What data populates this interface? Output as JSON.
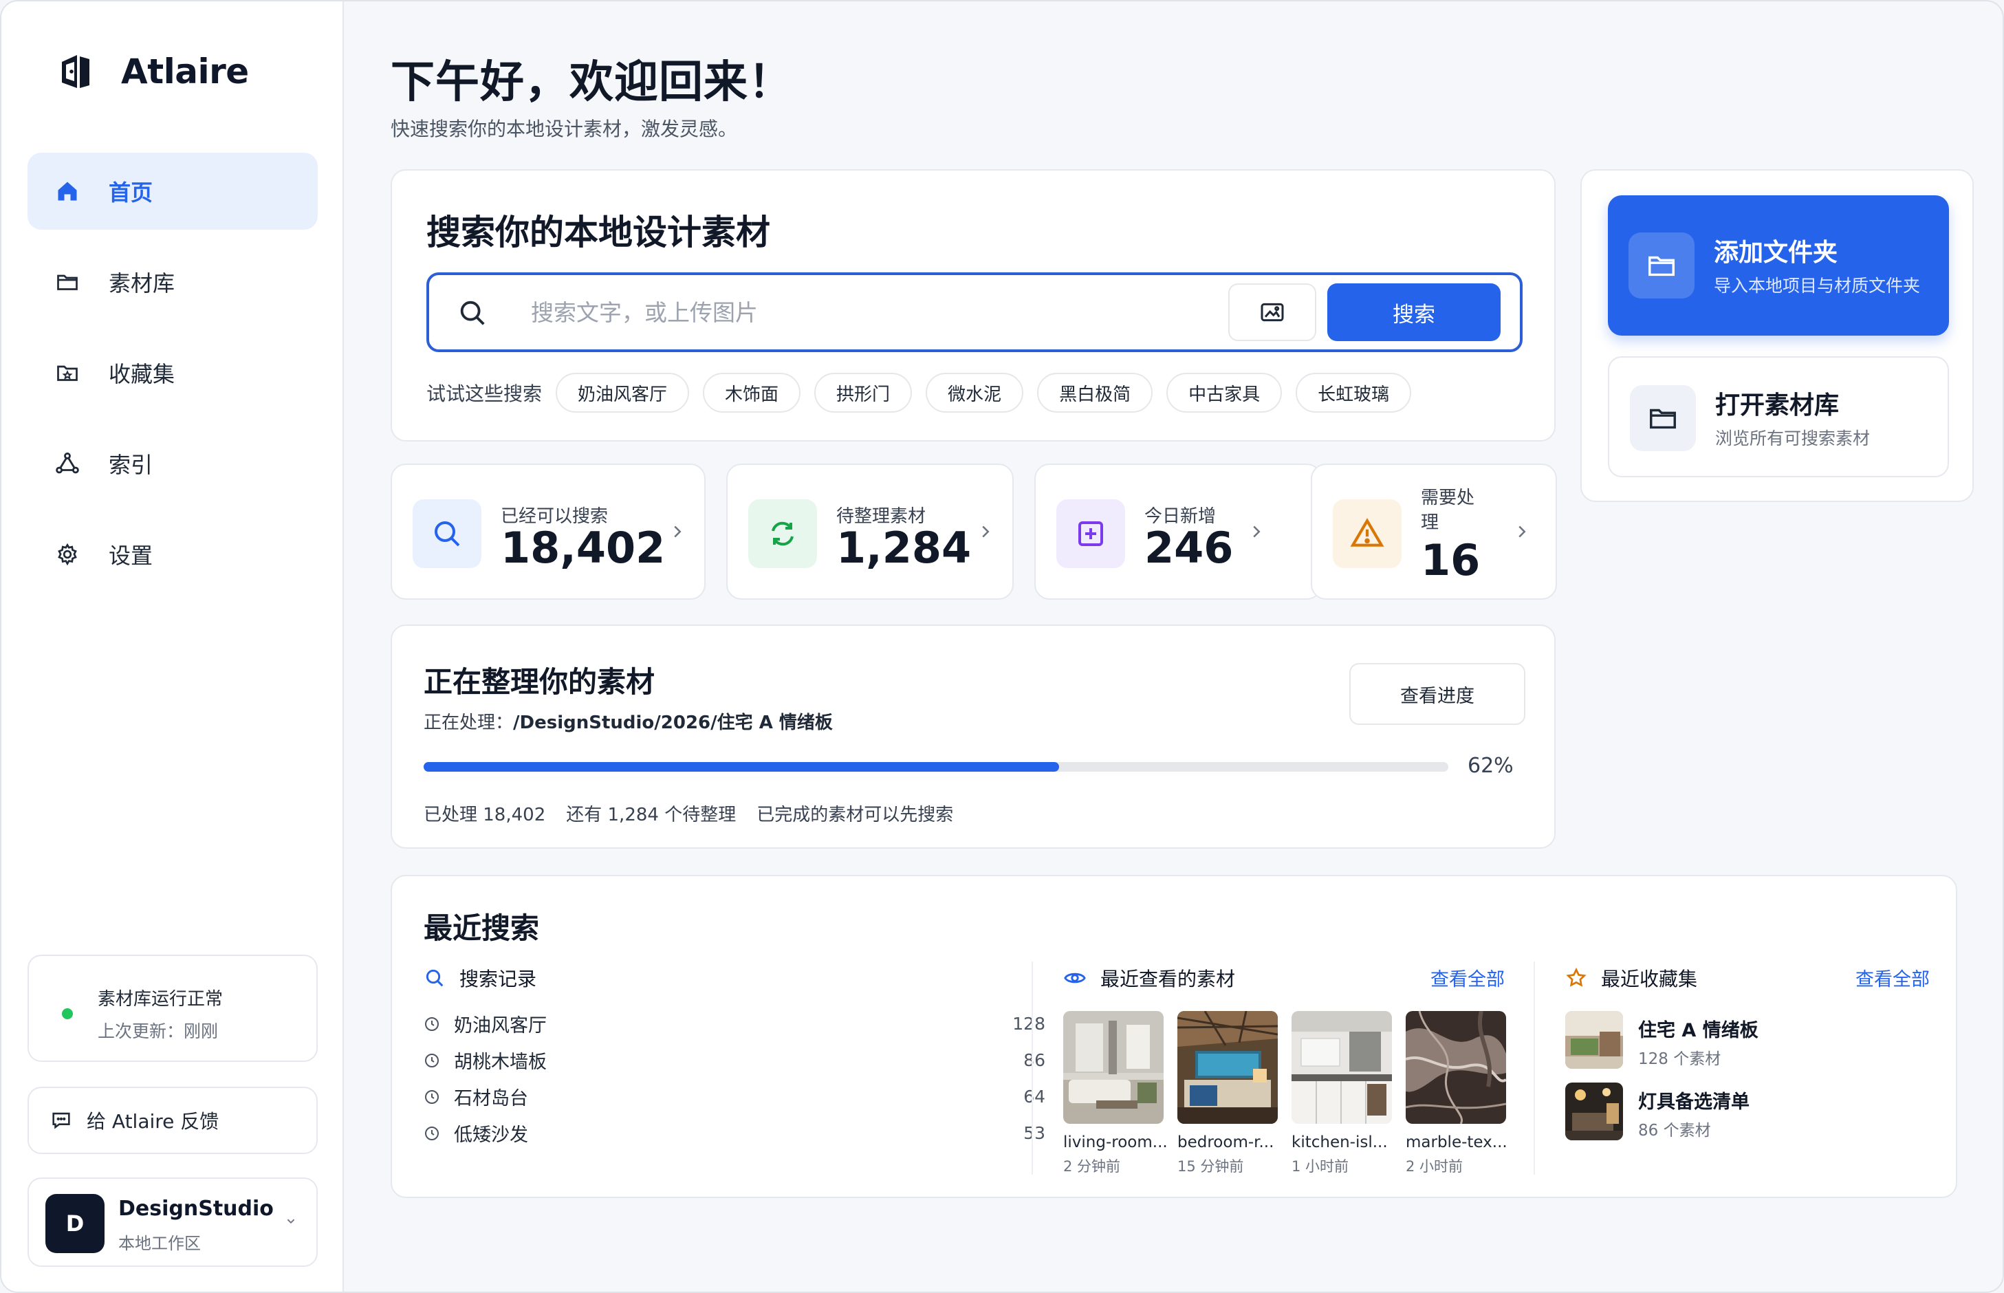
{
  "app": {
    "name": "Atlaire"
  },
  "sidebar": {
    "items": [
      {
        "label": "首页",
        "icon": "home-icon",
        "active": true
      },
      {
        "label": "素材库",
        "icon": "folder-icon",
        "active": false
      },
      {
        "label": "收藏集",
        "icon": "collection-icon",
        "active": false
      },
      {
        "label": "索引",
        "icon": "index-icon",
        "active": false
      },
      {
        "label": "设置",
        "icon": "gear-icon",
        "active": false
      }
    ],
    "status": {
      "title": "素材库运行正常",
      "updated": "上次更新：刚刚"
    },
    "feedback_label": "给 Atlaire 反馈",
    "workspace": {
      "initial": "D",
      "name": "DesignStudio",
      "type": "本地工作区"
    }
  },
  "header": {
    "greeting": "下午好，欢迎回来！",
    "subtitle": "快速搜索你的本地设计素材，激发灵感。"
  },
  "search": {
    "title": "搜索你的本地设计素材",
    "placeholder": "搜索文字，或上传图片",
    "button": "搜索",
    "suggest_label": "试试这些搜索",
    "suggestions": [
      "奶油风客厅",
      "木饰面",
      "拱形门",
      "微水泥",
      "黑白极简",
      "中古家具",
      "长虹玻璃"
    ]
  },
  "actions": {
    "add_folder": {
      "title": "添加文件夹",
      "subtitle": "导入本地项目与材质文件夹"
    },
    "open_library": {
      "title": "打开素材库",
      "subtitle": "浏览所有可搜索素材"
    }
  },
  "stats": [
    {
      "label": "已经可以搜索",
      "value": "18,402",
      "color": "#2563eb",
      "bg": "#eaf1fe"
    },
    {
      "label": "待整理素材",
      "value": "1,284",
      "color": "#16a34a",
      "bg": "#e8f7ee"
    },
    {
      "label": "今日新增",
      "value": "246",
      "color": "#7c3aed",
      "bg": "#f1ecfd"
    },
    {
      "label": "需要处理",
      "value": "16",
      "color": "#d97706",
      "bg": "#fdf3e4"
    }
  ],
  "progress": {
    "title": "正在整理你的素材",
    "path_label": "正在处理：",
    "path": "/DesignStudio/2026/住宅 A 情绪板",
    "button": "查看进度",
    "percent": 62,
    "percent_label": "62%",
    "processed": "已处理 18,402",
    "remaining": "还有 1,284 个待整理",
    "note": "已完成的素材可以先搜索"
  },
  "recent": {
    "title": "最近搜索",
    "history_title": "搜索记录",
    "history": [
      {
        "query": "奶油风客厅",
        "count": "128"
      },
      {
        "query": "胡桃木墙板",
        "count": "86"
      },
      {
        "query": "石材岛台",
        "count": "64"
      },
      {
        "query": "低矮沙发",
        "count": "53"
      }
    ],
    "viewed_title": "最近查看的素材",
    "viewed_see_all": "查看全部",
    "viewed": [
      {
        "name": "living-room...",
        "time": "2 分钟前"
      },
      {
        "name": "bedroom-r...",
        "time": "15 分钟前"
      },
      {
        "name": "kitchen-isl...",
        "time": "1 小时前"
      },
      {
        "name": "marble-tex...",
        "time": "2 小时前"
      }
    ],
    "collections_title": "最近收藏集",
    "collections_see_all": "查看全部",
    "collections": [
      {
        "name": "住宅 A 情绪板",
        "count": "128 个素材"
      },
      {
        "name": "灯具备选清单",
        "count": "86 个素材"
      }
    ]
  },
  "colors": {
    "accent": "#2563eb",
    "success": "#22c55e"
  }
}
